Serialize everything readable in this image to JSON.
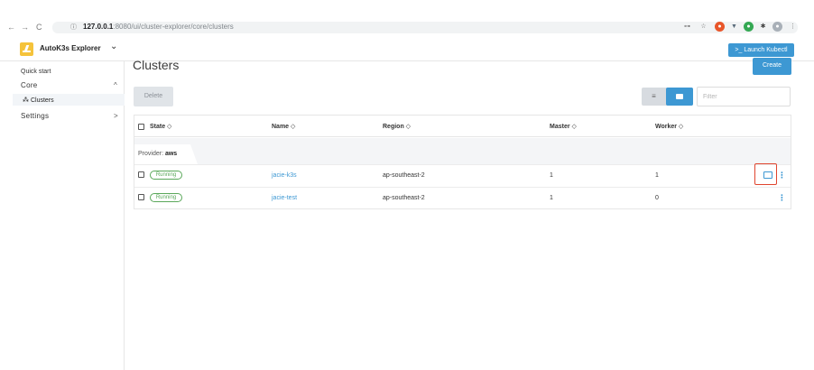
{
  "browser": {
    "url_host": "127.0.0.1",
    "url_port": ":8080",
    "url_path": "/ui/cluster-explorer/core/clusters",
    "back": "←",
    "forward": "→",
    "reload": "C",
    "info": "ⓘ"
  },
  "app": {
    "name": "AutoK3s Explorer",
    "chevron": "⌄",
    "kubectl_label": ">_ Launch Kubectl"
  },
  "sidebar": {
    "quick_start": "Quick start",
    "core": {
      "label": "Core",
      "caret": "^"
    },
    "clusters": {
      "icon": "⁂",
      "label": "Clusters"
    },
    "settings": {
      "label": "Settings",
      "caret": ">"
    }
  },
  "main": {
    "title": "Clusters",
    "create_label": "Create",
    "delete_label": "Delete",
    "filter_placeholder": "Filter",
    "view_flat_icon": "≡"
  },
  "table": {
    "columns": [
      "State ◇",
      "Name ◇",
      "Region ◇",
      "Master ◇",
      "Worker ◇"
    ],
    "group_prefix": "Provider: ",
    "group_value": "aws",
    "rows": [
      {
        "state": "Running",
        "name": "jacie-k3s",
        "region": "ap-southeast-2",
        "master": "1",
        "worker": "1"
      },
      {
        "state": "Running",
        "name": "jacie-test",
        "region": "ap-southeast-2",
        "master": "1",
        "worker": "0"
      }
    ],
    "kebab": "⋮"
  },
  "colors": {
    "accent": "#3d98d3",
    "running": "#5aa85a",
    "highlight": "#e0452f",
    "logo": "#f5c33b"
  }
}
